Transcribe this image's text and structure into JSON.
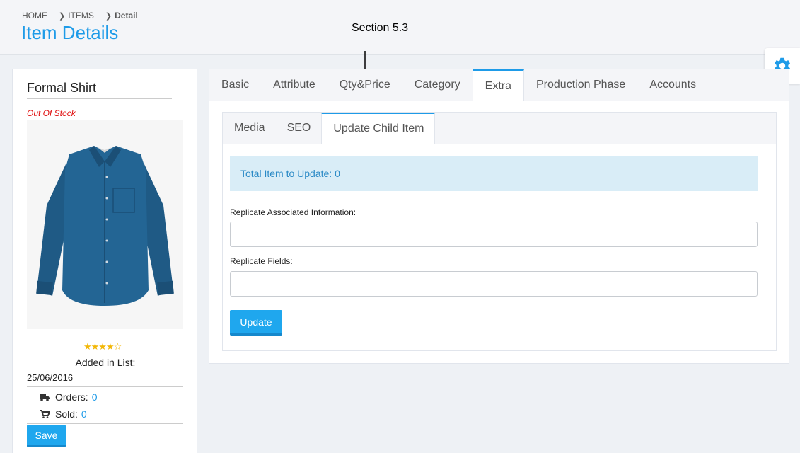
{
  "breadcrumb": {
    "home": "HOME",
    "items": "ITEMS",
    "detail": "Detail"
  },
  "page_title": "Item Details",
  "annotation": "Section 5.3",
  "product": {
    "name": "Formal Shirt",
    "stock_status": "Out Of Stock",
    "rating_stars": "★★★★☆",
    "rating": 4,
    "rating_max": 5,
    "added_label": "Added in List:",
    "added_date": "25/06/2016",
    "orders_label": "Orders:",
    "orders_value": "0",
    "sold_label": "Sold:",
    "sold_value": "0",
    "save_label": "Save"
  },
  "main_tabs": [
    "Basic",
    "Attribute",
    "Qty&Price",
    "Category",
    "Extra",
    "Production Phase",
    "Accounts"
  ],
  "active_main_tab": "Extra",
  "sub_tabs": [
    "Media",
    "SEO",
    "Update Child Item"
  ],
  "active_sub_tab": "Update Child Item",
  "update_child": {
    "info_text": "Total Item to Update: 0",
    "replicate_info_label": "Replicate Associated Information:",
    "replicate_info_value": "",
    "replicate_fields_label": "Replicate Fields:",
    "replicate_fields_value": "",
    "update_label": "Update"
  },
  "colors": {
    "accent": "#1e9be8",
    "button": "#1fa7ee",
    "out_of_stock": "#e01010",
    "info_bg": "#d9edf7",
    "star": "#f2b707",
    "shirt": "#1f5a85"
  },
  "icons": {
    "settings": "gear-icon",
    "orders": "truck-icon",
    "sold": "cart-icon",
    "breadcrumb_sep": "chevron-right-icon"
  }
}
